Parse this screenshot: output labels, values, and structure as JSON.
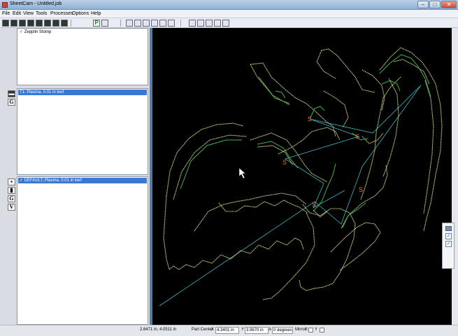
{
  "window": {
    "title": "SheetCam - Untitled.job",
    "app_icon": "sheetcam-icon"
  },
  "menu": [
    "File",
    "Edit",
    "View",
    "Tools",
    "Processes",
    "Options",
    "Help"
  ],
  "toolbar": {
    "part_button_label": "P"
  },
  "part_tree": {
    "items": [
      {
        "label": "Zepplin Stomp",
        "checked": true
      }
    ]
  },
  "tool_pane": {
    "items": [
      {
        "label": "T1: Plasma, 0.01 in kerf",
        "selected": true
      }
    ]
  },
  "operation_pane": {
    "items": [
      {
        "label": "DEFAULT, Plasma, 0.01 in kerf",
        "checked": true,
        "selected": true
      }
    ]
  },
  "side_icons": {
    "g_label": "G",
    "v_label": "V"
  },
  "status": {
    "cursor_position": "2.6471 in, 4.0511 in",
    "part_center_label": "Part Center",
    "x_label": "X",
    "x_value": "4.3401 in",
    "y_label": "Y",
    "y_value": "3.9670 in",
    "angle_label": "A",
    "angle_value": "0 degrees",
    "mirror_label": "Mirror",
    "mirror_x_label": "X",
    "mirror_y_label": "Y"
  },
  "colors": {
    "canvas_bg": "#000000",
    "outline": "#d8e08a",
    "toolpath": "#3fb34a",
    "rapid": "#3bb7c4",
    "start_marker": "#e07a2a"
  },
  "start_marker_text": "S"
}
